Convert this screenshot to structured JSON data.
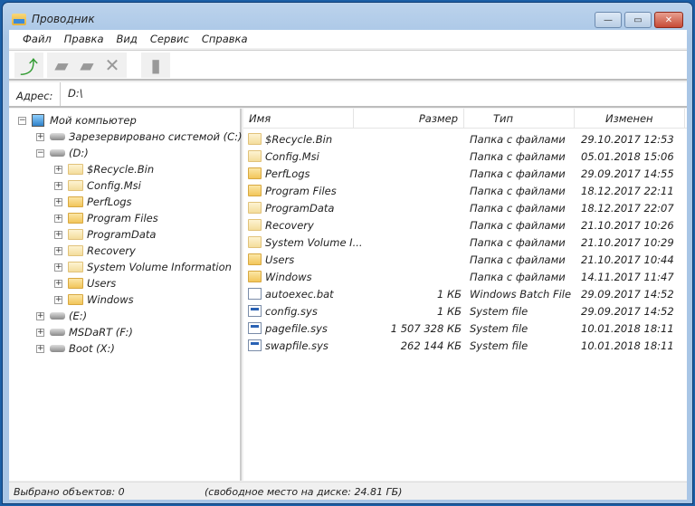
{
  "window": {
    "title": "Проводник",
    "minimize": "—",
    "maximize": "▭",
    "close": "✕"
  },
  "menu": [
    "Файл",
    "Правка",
    "Вид",
    "Сервис",
    "Справка"
  ],
  "toolbar": {
    "buttons": [
      {
        "name": "up-folder-icon",
        "glyph": "⤴",
        "enabled": true
      },
      {
        "name": "open-folder-icon",
        "glyph": "▰",
        "enabled": false
      },
      {
        "name": "copy-icon",
        "glyph": "▰",
        "enabled": false
      },
      {
        "name": "delete-icon",
        "glyph": "✕",
        "enabled": false
      },
      {
        "name": "properties-icon",
        "glyph": "▮",
        "enabled": false
      }
    ]
  },
  "address": {
    "label": "Адрес:",
    "value": "D:\\"
  },
  "tree": [
    {
      "label": "Мой компьютер",
      "level": 0,
      "icon": "computer",
      "expander": "−"
    },
    {
      "label": "Зарезервировано системой (C:)",
      "level": 1,
      "icon": "drive",
      "expander": "+"
    },
    {
      "label": "(D:)",
      "level": 1,
      "icon": "drive",
      "expander": "−"
    },
    {
      "label": "$Recycle.Bin",
      "level": 2,
      "icon": "folder-pale",
      "expander": "+"
    },
    {
      "label": "Config.Msi",
      "level": 2,
      "icon": "folder-pale",
      "expander": "+"
    },
    {
      "label": "PerfLogs",
      "level": 2,
      "icon": "folder",
      "expander": "+"
    },
    {
      "label": "Program Files",
      "level": 2,
      "icon": "folder",
      "expander": "+"
    },
    {
      "label": "ProgramData",
      "level": 2,
      "icon": "folder-pale",
      "expander": "+"
    },
    {
      "label": "Recovery",
      "level": 2,
      "icon": "folder-pale",
      "expander": "+"
    },
    {
      "label": "System Volume Information",
      "level": 2,
      "icon": "folder-pale",
      "expander": "+"
    },
    {
      "label": "Users",
      "level": 2,
      "icon": "folder",
      "expander": "+"
    },
    {
      "label": "Windows",
      "level": 2,
      "icon": "folder",
      "expander": "+"
    },
    {
      "label": "(E:)",
      "level": 1,
      "icon": "drive",
      "expander": "+"
    },
    {
      "label": "MSDaRT (F:)",
      "level": 1,
      "icon": "drive",
      "expander": "+"
    },
    {
      "label": "Boot (X:)",
      "level": 1,
      "icon": "drive",
      "expander": "+"
    }
  ],
  "columns": {
    "name": "Имя",
    "size": "Размер",
    "type": "Тип",
    "modified": "Изменен"
  },
  "files": [
    {
      "name": "$Recycle.Bin",
      "size": "",
      "type": "Папка с файлами",
      "modified": "29.10.2017 12:53",
      "icon": "folder-pale"
    },
    {
      "name": "Config.Msi",
      "size": "",
      "type": "Папка с файлами",
      "modified": "05.01.2018 15:06",
      "icon": "folder-pale"
    },
    {
      "name": "PerfLogs",
      "size": "",
      "type": "Папка с файлами",
      "modified": "29.09.2017 14:55",
      "icon": "folder"
    },
    {
      "name": "Program Files",
      "size": "",
      "type": "Папка с файлами",
      "modified": "18.12.2017 22:11",
      "icon": "folder"
    },
    {
      "name": "ProgramData",
      "size": "",
      "type": "Папка с файлами",
      "modified": "18.12.2017 22:07",
      "icon": "folder-pale"
    },
    {
      "name": "Recovery",
      "size": "",
      "type": "Папка с файлами",
      "modified": "21.10.2017 10:26",
      "icon": "folder-pale"
    },
    {
      "name": "System Volume I...",
      "size": "",
      "type": "Папка с файлами",
      "modified": "21.10.2017 10:29",
      "icon": "folder-pale"
    },
    {
      "name": "Users",
      "size": "",
      "type": "Папка с файлами",
      "modified": "21.10.2017 10:44",
      "icon": "folder"
    },
    {
      "name": "Windows",
      "size": "",
      "type": "Папка с файлами",
      "modified": "14.11.2017 11:47",
      "icon": "folder"
    },
    {
      "name": "autoexec.bat",
      "size": "1 КБ",
      "type": "Windows Batch File",
      "modified": "29.09.2017 14:52",
      "icon": "batch-file"
    },
    {
      "name": "config.sys",
      "size": "1 КБ",
      "type": "System file",
      "modified": "29.09.2017 14:52",
      "icon": "system-file"
    },
    {
      "name": "pagefile.sys",
      "size": "1 507 328 КБ",
      "type": "System file",
      "modified": "10.01.2018 18:11",
      "icon": "system-file"
    },
    {
      "name": "swapfile.sys",
      "size": "262 144 КБ",
      "type": "System file",
      "modified": "10.01.2018 18:11",
      "icon": "system-file"
    }
  ],
  "status": {
    "selected": "Выбрано объектов: 0",
    "free": "(свободное место на диске: 24.81 ГБ)"
  }
}
